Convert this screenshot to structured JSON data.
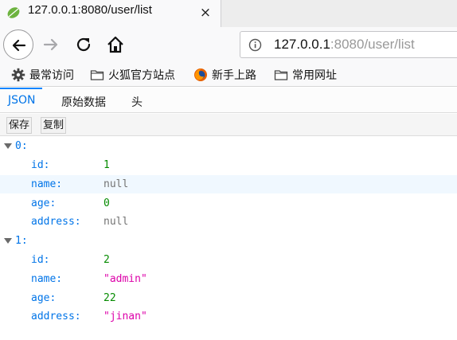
{
  "tab": {
    "title": "127.0.0.1:8080/user/list",
    "close_icon": "×"
  },
  "urlbar": {
    "host": "127.0.0.1",
    "rest": ":8080/user/list"
  },
  "bookmarks": [
    {
      "label": "最常访问",
      "icon": "gear-icon"
    },
    {
      "label": "火狐官方站点",
      "icon": "folder-icon"
    },
    {
      "label": "新手上路",
      "icon": "firefox-icon"
    },
    {
      "label": "常用网址",
      "icon": "folder-icon"
    }
  ],
  "viewer": {
    "tabs": [
      "JSON",
      "原始数据",
      "头"
    ],
    "actions": {
      "save": "保存",
      "copy": "复制"
    }
  },
  "json": {
    "groups": [
      {
        "index": "0:",
        "fields": [
          {
            "key": "id:",
            "value": "1",
            "kind": "num"
          },
          {
            "key": "name:",
            "value": "null",
            "kind": "nul"
          },
          {
            "key": "age:",
            "value": "0",
            "kind": "num"
          },
          {
            "key": "address:",
            "value": "null",
            "kind": "nul"
          }
        ]
      },
      {
        "index": "1:",
        "fields": [
          {
            "key": "id:",
            "value": "2",
            "kind": "num"
          },
          {
            "key": "name:",
            "value": "\"admin\"",
            "kind": "str"
          },
          {
            "key": "age:",
            "value": "22",
            "kind": "num"
          },
          {
            "key": "address:",
            "value": "\"jinan\"",
            "kind": "str"
          }
        ]
      }
    ]
  },
  "colors": {
    "key": "#0074e8",
    "number": "#058b00",
    "null": "#737373",
    "string": "#dd00a9",
    "hover_row": "#f0f8ff"
  }
}
